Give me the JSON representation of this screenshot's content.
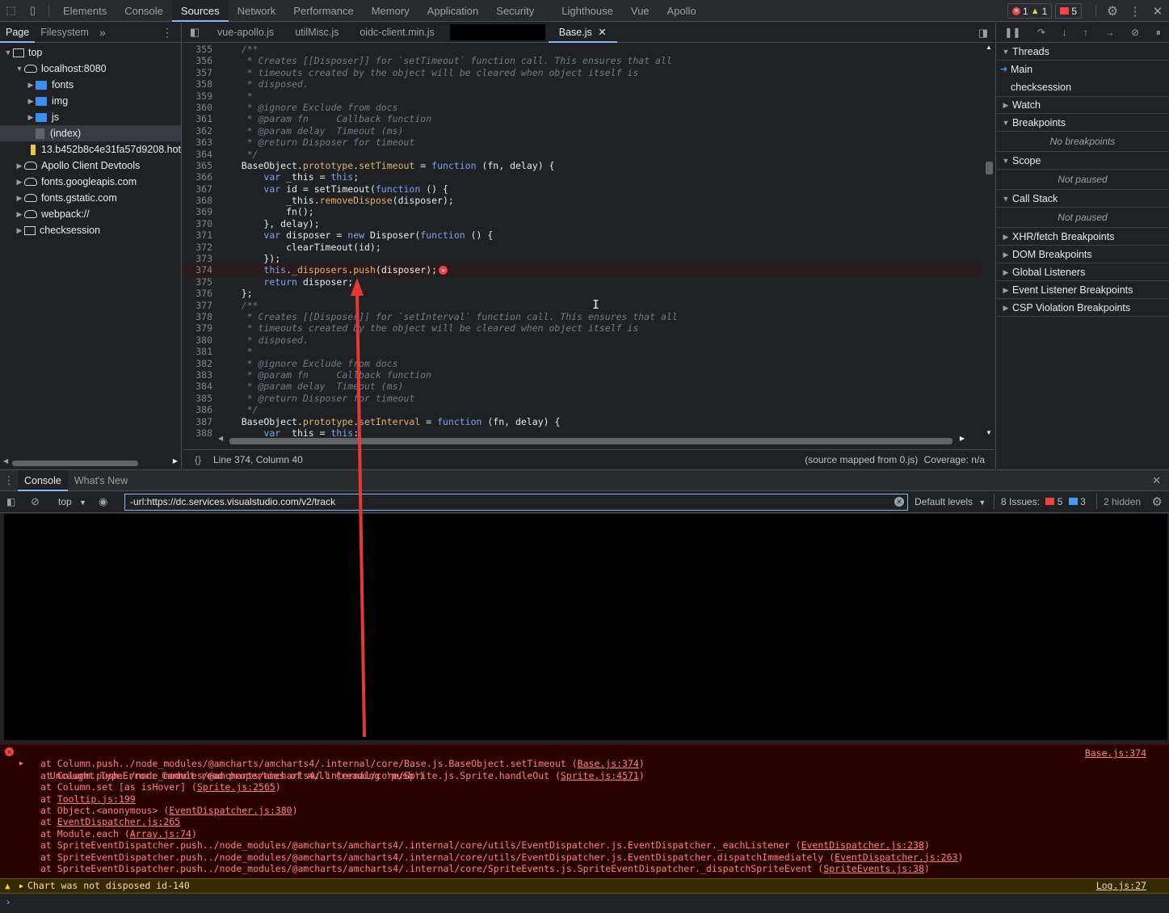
{
  "topbar": {
    "tabs": [
      "Elements",
      "Console",
      "Sources",
      "Network",
      "Performance",
      "Memory",
      "Application",
      "Security",
      "Lighthouse",
      "Vue",
      "Apollo"
    ],
    "active_tab": "Sources",
    "errors": "1",
    "warnings": "1",
    "issues": "5"
  },
  "navigator": {
    "tabs": [
      "Page",
      "Filesystem"
    ],
    "tree": [
      {
        "label": "top",
        "depth": 0,
        "expanded": true,
        "icon": "frame-icon"
      },
      {
        "label": "localhost:8080",
        "depth": 1,
        "expanded": true,
        "icon": "cloud-icon"
      },
      {
        "label": "fonts",
        "depth": 2,
        "expanded": false,
        "icon": "folder-icon"
      },
      {
        "label": "img",
        "depth": 2,
        "expanded": false,
        "icon": "folder-icon"
      },
      {
        "label": "js",
        "depth": 2,
        "expanded": false,
        "icon": "folder-icon"
      },
      {
        "label": "(index)",
        "depth": 2,
        "selected": true,
        "icon": "file-icon"
      },
      {
        "label": "13.b452b8c4e31fa57d9208.hot",
        "depth": 2,
        "icon": "script-file-icon"
      },
      {
        "label": "Apollo Client Devtools",
        "depth": 1,
        "expanded": false,
        "icon": "cloud-icon"
      },
      {
        "label": "fonts.googleapis.com",
        "depth": 1,
        "expanded": false,
        "icon": "cloud-icon"
      },
      {
        "label": "fonts.gstatic.com",
        "depth": 1,
        "expanded": false,
        "icon": "cloud-icon"
      },
      {
        "label": "webpack://",
        "depth": 1,
        "expanded": false,
        "icon": "cloud-icon"
      },
      {
        "label": "checksession",
        "depth": 1,
        "expanded": false,
        "icon": "frame-icon"
      }
    ]
  },
  "editor": {
    "tabs": [
      "vue-apollo.js",
      "utilMisc.js",
      "oidc-client.min.js",
      "",
      "Base.js"
    ],
    "active_tab": "Base.js",
    "status_position": "Line 374, Column 40",
    "status_source": "(source mapped from 0.js)",
    "status_coverage": "Coverage: n/a",
    "error_line": "374",
    "lines": [
      {
        "n": "355",
        "t": "    /**",
        "k": "comment"
      },
      {
        "n": "356",
        "t": "     * Creates [[Disposer]] for `setTimeout` function call. This ensures that all",
        "k": "comment"
      },
      {
        "n": "357",
        "t": "     * timeouts created by the object will be cleared when object itself is",
        "k": "comment"
      },
      {
        "n": "358",
        "t": "     * disposed.",
        "k": "comment"
      },
      {
        "n": "359",
        "t": "     *",
        "k": "comment"
      },
      {
        "n": "360",
        "t": "     * @ignore Exclude from docs",
        "k": "comment"
      },
      {
        "n": "361",
        "t": "     * @param fn     Callback function",
        "k": "comment"
      },
      {
        "n": "362",
        "t": "     * @param delay  Timeout (ms)",
        "k": "comment"
      },
      {
        "n": "363",
        "t": "     * @return Disposer for timeout",
        "k": "comment"
      },
      {
        "n": "364",
        "t": "     */",
        "k": "comment"
      },
      {
        "n": "365",
        "t": "    BaseObject.prototype.setTimeout = function (fn, delay) {",
        "k": "code"
      },
      {
        "n": "366",
        "t": "        var _this = this;",
        "k": "code"
      },
      {
        "n": "367",
        "t": "        var id = setTimeout(function () {",
        "k": "code"
      },
      {
        "n": "368",
        "t": "            _this.removeDispose(disposer);",
        "k": "code"
      },
      {
        "n": "369",
        "t": "            fn();",
        "k": "code"
      },
      {
        "n": "370",
        "t": "        }, delay);",
        "k": "code"
      },
      {
        "n": "371",
        "t": "        var disposer = new Disposer(function () {",
        "k": "code"
      },
      {
        "n": "372",
        "t": "            clearTimeout(id);",
        "k": "code"
      },
      {
        "n": "373",
        "t": "        });",
        "k": "code"
      },
      {
        "n": "374",
        "t": "        this._disposers.push(disposer);",
        "k": "code"
      },
      {
        "n": "375",
        "t": "        return disposer;",
        "k": "code"
      },
      {
        "n": "376",
        "t": "    };",
        "k": "code"
      },
      {
        "n": "377",
        "t": "    /**",
        "k": "comment"
      },
      {
        "n": "378",
        "t": "     * Creates [[Disposer]] for `setInterval` function call. This ensures that all",
        "k": "comment"
      },
      {
        "n": "379",
        "t": "     * timeouts created by the object will be cleared when object itself is",
        "k": "comment"
      },
      {
        "n": "380",
        "t": "     * disposed.",
        "k": "comment"
      },
      {
        "n": "381",
        "t": "     *",
        "k": "comment"
      },
      {
        "n": "382",
        "t": "     * @ignore Exclude from docs",
        "k": "comment"
      },
      {
        "n": "383",
        "t": "     * @param fn     Callback function",
        "k": "comment"
      },
      {
        "n": "384",
        "t": "     * @param delay  Timeout (ms)",
        "k": "comment"
      },
      {
        "n": "385",
        "t": "     * @return Disposer for timeout",
        "k": "comment"
      },
      {
        "n": "386",
        "t": "     */",
        "k": "comment"
      },
      {
        "n": "387",
        "t": "    BaseObject.prototype.setInterval = function (fn, delay) {",
        "k": "code"
      },
      {
        "n": "388",
        "t": "        var _this = this;",
        "k": "code"
      },
      {
        "n": "389",
        "t": "",
        "k": "code"
      }
    ]
  },
  "debugger": {
    "threads_label": "Threads",
    "threads": [
      "Main",
      "checksession"
    ],
    "watch_label": "Watch",
    "breakpoints_label": "Breakpoints",
    "breakpoints_msg": "No breakpoints",
    "scope_label": "Scope",
    "scope_msg": "Not paused",
    "callstack_label": "Call Stack",
    "callstack_msg": "Not paused",
    "extra_panes": [
      "XHR/fetch Breakpoints",
      "DOM Breakpoints",
      "Global Listeners",
      "Event Listener Breakpoints",
      "CSP Violation Breakpoints"
    ]
  },
  "drawer": {
    "tabs": [
      "Console",
      "What's New"
    ],
    "active_tab": "Console"
  },
  "console": {
    "context": "top",
    "filter": "-url:https://dc.services.visualstudio.com/v2/track",
    "levels": "Default levels",
    "issues_label": "8 Issues:",
    "issues_errors": "5",
    "issues_info": "3",
    "hidden": "2 hidden",
    "error": {
      "message": "Uncaught TypeError: Cannot read properties of null (reading 'push')",
      "source": "Base.js:374",
      "stack": [
        {
          "pre": "at Column.push../node_modules/@amcharts/amcharts4/.internal/core/Base.js.BaseObject.setTimeout (",
          "link": "Base.js:374",
          "post": ")"
        },
        {
          "pre": "at Column.push../node_modules/@amcharts/amcharts4/.internal/core/Sprite.js.Sprite.handleOut (",
          "link": "Sprite.js:4571",
          "post": ")"
        },
        {
          "pre": "at Column.set [as isHover] (",
          "link": "Sprite.js:2565",
          "post": ")"
        },
        {
          "pre": "at ",
          "link": "Tooltip.js:199",
          "post": ""
        },
        {
          "pre": "at Object.<anonymous> (",
          "link": "EventDispatcher.js:380",
          "post": ")"
        },
        {
          "pre": "at ",
          "link": "EventDispatcher.js:265",
          "post": ""
        },
        {
          "pre": "at Module.each (",
          "link": "Array.js:74",
          "post": ")"
        },
        {
          "pre": "at SpriteEventDispatcher.push../node_modules/@amcharts/amcharts4/.internal/core/utils/EventDispatcher.js.EventDispatcher._eachListener (",
          "link": "EventDispatcher.js:238",
          "post": ")"
        },
        {
          "pre": "at SpriteEventDispatcher.push../node_modules/@amcharts/amcharts4/.internal/core/utils/EventDispatcher.js.EventDispatcher.dispatchImmediately (",
          "link": "EventDispatcher.js:263",
          "post": ")"
        },
        {
          "pre": "at SpriteEventDispatcher.push../node_modules/@amcharts/amcharts4/.internal/core/SpriteEvents.js.SpriteEventDispatcher._dispatchSpriteEvent (",
          "link": "SpriteEvents.js:38",
          "post": ")"
        }
      ]
    },
    "warning": {
      "message": "Chart was not disposed id-140",
      "source": "Log.js:27"
    }
  },
  "colors": {
    "accent": "#8ab4f8",
    "error": "#ee4444",
    "warning": "#f7c948",
    "annotation_arrow": "#e53935"
  }
}
